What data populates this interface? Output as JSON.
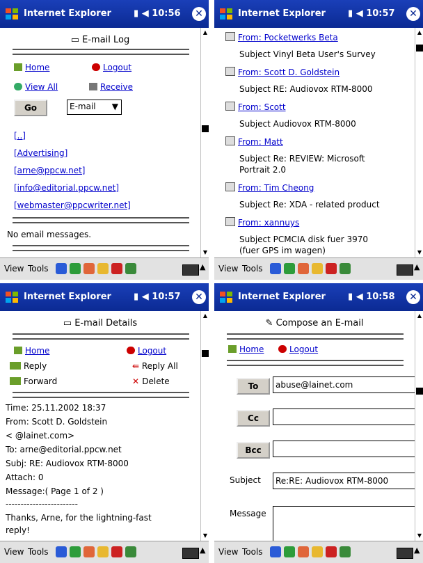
{
  "titlebar": {
    "title": "Internet Explorer",
    "close": "✕"
  },
  "status_times": [
    "10:56",
    "10:57",
    "10:57",
    "10:58"
  ],
  "menu": {
    "view": "View",
    "tools": "Tools"
  },
  "log": {
    "heading": "E-mail Log",
    "home": "Home",
    "logout": "Logout",
    "view_all": "View All",
    "receive": "Receive",
    "go": "Go",
    "select_value": "E-mail",
    "folders": [
      "[..]",
      "[Advertising]",
      "[arne@ppcw.net]",
      "[info@editorial.ppcw.net]",
      "[webmaster@ppcwriter.net]"
    ],
    "empty": "No email messages."
  },
  "inbox": {
    "messages": [
      {
        "from": "From: Pocketwerks Beta",
        "subject": "Subject Vinyl Beta User's Survey"
      },
      {
        "from": "From: Scott D. Goldstein",
        "subject": "Subject RE: Audiovox RTM-8000"
      },
      {
        "from": "From: Scott",
        "subject": "Subject Audiovox RTM-8000"
      },
      {
        "from": "From: Matt",
        "subject": "Subject Re: REVIEW: Microsoft",
        "subject2": "Portrait 2.0"
      },
      {
        "from": "From: Tim Cheong",
        "subject": "Subject Re: XDA - related product"
      },
      {
        "from": "From: xannuys",
        "subject": "Subject PCMCIA disk fuer 3970",
        "subject2": "(fuer GPS im wagen)"
      }
    ]
  },
  "details": {
    "heading": "E-mail Details",
    "home": "Home",
    "logout": "Logout",
    "reply": "Reply",
    "reply_all": "Reply All",
    "forward": "Forward",
    "delete": "Delete",
    "lines": [
      "Time: 25.11.2002 18:37",
      "From: Scott D. Goldstein",
      "<          @lainet.com>",
      "To: arne@editorial.ppcw.net",
      "Subj: RE: Audiovox RTM-8000",
      "Attach: 0",
      "Message:( Page 1 of 2 )",
      "------------------------",
      "Thanks, Arne, for the lightning-fast",
      "reply!"
    ]
  },
  "compose": {
    "heading": "Compose an E-mail",
    "home": "Home",
    "logout": "Logout",
    "to_label": "To",
    "to_value": "abuse@lainet.com",
    "cc_label": "Cc",
    "bcc_label": "Bcc",
    "subject_label": "Subject",
    "subject_value": "Re:RE: Audiovox RTM-8000",
    "message_label": "Message"
  }
}
